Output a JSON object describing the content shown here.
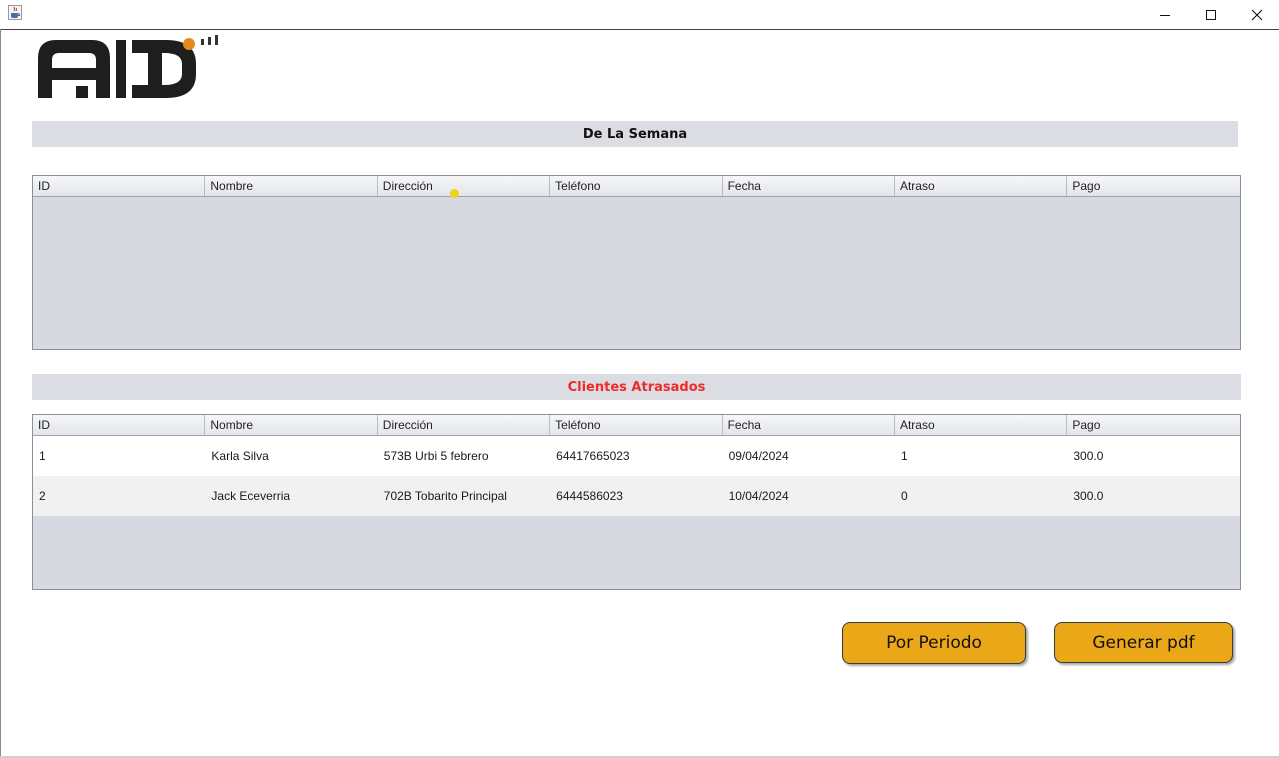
{
  "window": {
    "app_icon": "java-cup-icon",
    "controls": [
      "minimize-icon",
      "maximize-icon",
      "close-icon"
    ]
  },
  "logo": {
    "text": "AD",
    "accent_color": "#e58a1f"
  },
  "section_week": {
    "title": "De La Semana"
  },
  "section_overdue": {
    "title": "Clientes Atrasados",
    "title_color": "#ee2b2b"
  },
  "columns": [
    "ID",
    "Nombre",
    "Dirección",
    "Teléfono",
    "Fecha",
    "Atraso",
    "Pago"
  ],
  "table_week": {
    "rows": []
  },
  "table_overdue": {
    "rows": [
      [
        "1",
        "Karla Silva",
        "573B Urbi 5 febrero",
        "64417665023",
        "09/04/2024",
        "1",
        "300.0"
      ],
      [
        "2",
        "Jack Eceverria",
        "702B Tobarito Principal",
        "6444586023",
        "10/04/2024",
        "0",
        "300.0"
      ]
    ]
  },
  "buttons": {
    "period_label": "Por Periodo",
    "pdf_label": "Generar pdf",
    "color": "#eaa717"
  }
}
